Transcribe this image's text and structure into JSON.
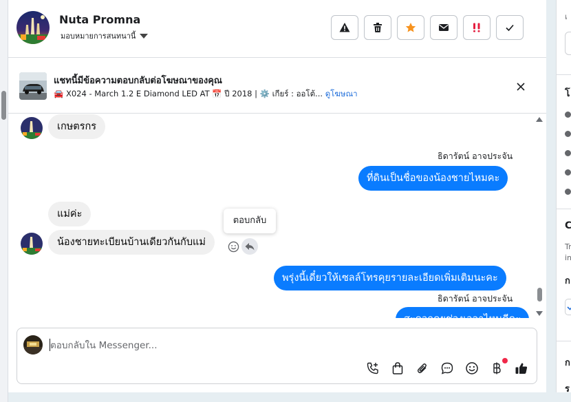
{
  "colors": {
    "accent": "#0a7cff",
    "link": "#216fdb",
    "warning_star": "#f7931e",
    "urgent": "#e41e3f",
    "incoming_bubble": "#f0f0f0"
  },
  "header": {
    "contact_name": "Nuta Promna",
    "assignment_label": "มอบหมายการสนทนานี้",
    "actions": [
      {
        "name": "report",
        "icon": "warning-icon"
      },
      {
        "name": "delete",
        "icon": "trash-icon"
      },
      {
        "name": "star",
        "icon": "star-icon"
      },
      {
        "name": "mark-unread",
        "icon": "envelope-icon"
      },
      {
        "name": "follow-up",
        "icon": "urgent-icon"
      },
      {
        "name": "done",
        "icon": "check-icon"
      }
    ]
  },
  "ad_banner": {
    "title": "แชทนี้มีข้อความตอบกลับต่อโฆษณาของคุณ",
    "detail": "🚘 X024 - March 1.2 E Diamond LED AT 📅 ปี 2018 | ⚙️ เกียร์ : ออโต้...",
    "link_label": "ดูโฆษณา",
    "close_icon": "close-icon"
  },
  "messages": [
    {
      "direction": "in",
      "text": "เกษตรกร",
      "show_avatar": true
    },
    {
      "direction": "out",
      "sender": "ธิดารัตน์ อาจประจัน",
      "text": "ที่ดินเป็นชื่อของน้องชายไหมคะ"
    },
    {
      "direction": "in",
      "text": "แม่ค่ะ",
      "show_avatar": false
    },
    {
      "direction": "in",
      "text": "น้องชายทะเบียนบ้านเดียวกันกับแม่",
      "show_avatar": true
    },
    {
      "direction": "out",
      "text": "พรุ่งนี้เดี๋ยวให้เซลล์โทรคุยรายละเอียดเพิ่มเติมนะคะ"
    },
    {
      "direction": "out",
      "sender": "ธิดารัตน์ อาจประจัน",
      "text": "สะดวกคุยช่วงเวลาไหนดีคะ"
    }
  ],
  "reply_tooltip": "ตอบกลับ",
  "composer": {
    "placeholder": "ตอบกลับใน Messenger...",
    "tools": [
      "phone-icon",
      "bag-icon",
      "paperclip-icon",
      "saved-reply-icon",
      "emoji-icon",
      "baht-icon",
      "thumbs-up-icon"
    ]
  },
  "right_panel": {
    "fragments": [
      "เ",
      "โ",
      "C",
      "Tr",
      "in",
      "ก",
      "ก",
      "ร"
    ]
  }
}
